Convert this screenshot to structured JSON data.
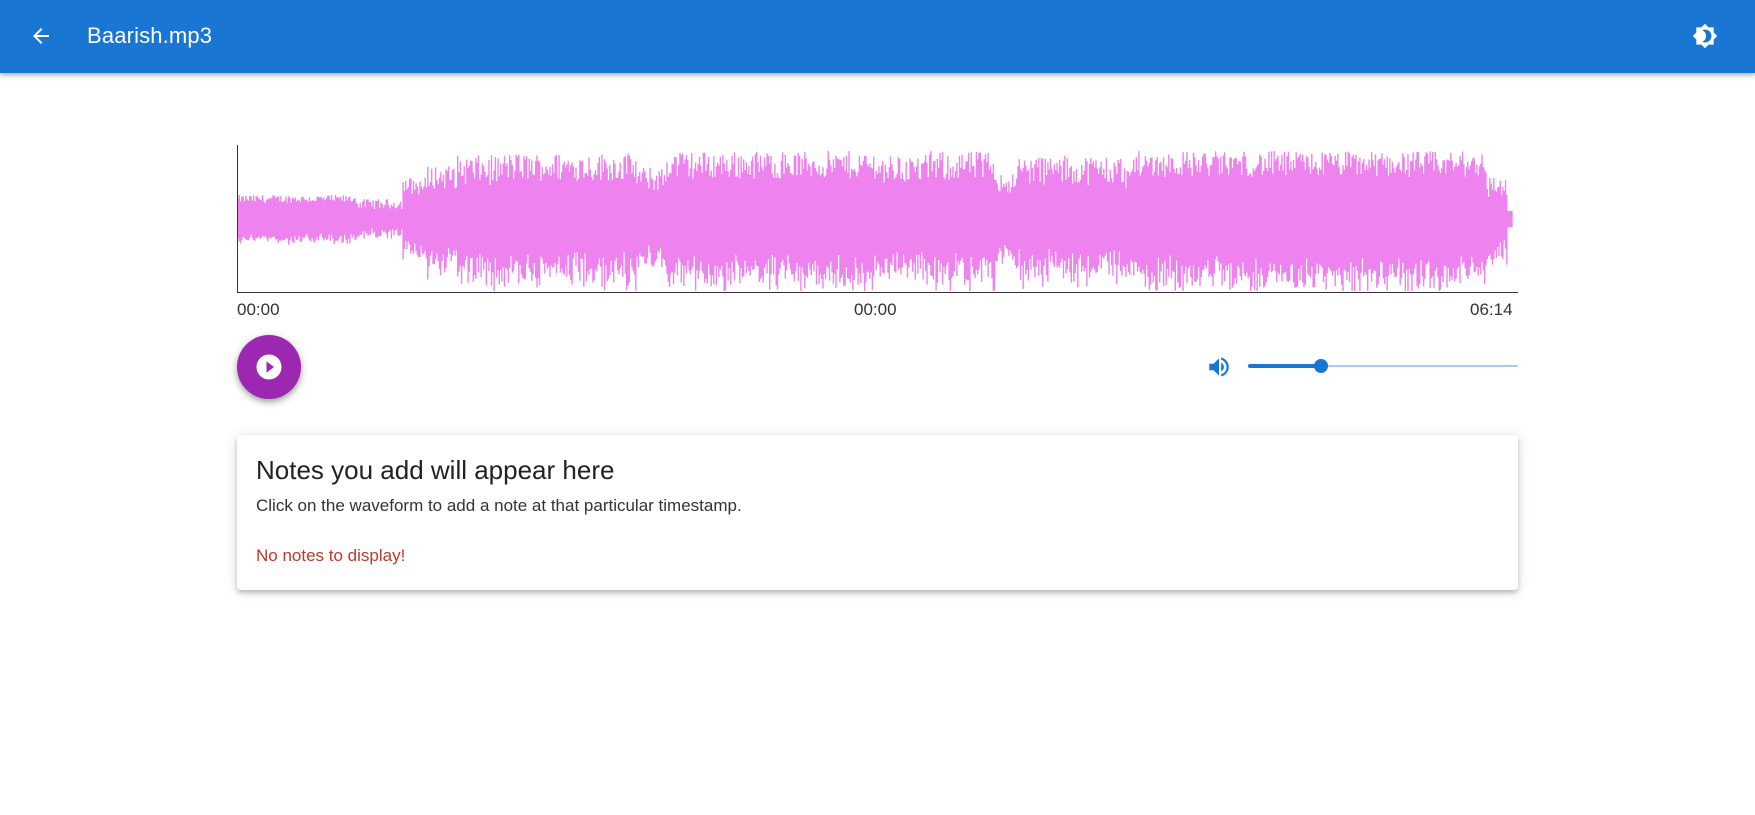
{
  "app_bar": {
    "title": "Baarish.mp3",
    "background": "#1976d2",
    "back_icon": "arrow-back-icon",
    "theme_icon": "brightness-toggle-icon"
  },
  "player": {
    "waveform_color": "#ee82ee",
    "time_start": "00:00",
    "time_current": "00:00",
    "time_end": "06:14",
    "play_icon": "play-icon",
    "play_button_color": "#9c27b0",
    "volume_icon": "volume-up-icon",
    "volume_level": 0.27,
    "accent_color": "#1976d2"
  },
  "notes": {
    "title": "Notes you add will appear here",
    "subtitle": "Click on the waveform to add a note at that particular timestamp.",
    "empty_message": "No notes to display!",
    "empty_color": "#c0392b"
  }
}
